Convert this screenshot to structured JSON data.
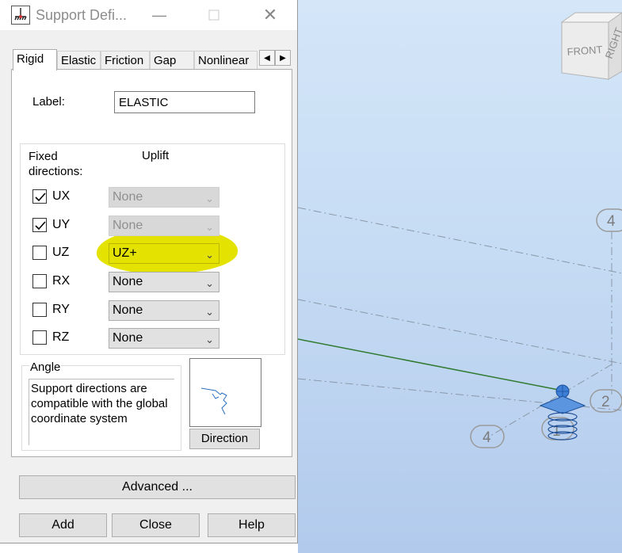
{
  "dialog": {
    "title": "Support Defi...",
    "tabs": [
      "Rigid",
      "Elastic",
      "Friction",
      "Gap",
      "Nonlinear"
    ],
    "active_tab": "Rigid",
    "label_caption": "Label:",
    "label_value": "ELASTIC",
    "fixed_header": "Fixed directions:",
    "uplift_header": "Uplift",
    "dofs": [
      {
        "name": "UX",
        "checked": true,
        "uplift": "None",
        "enabled": false
      },
      {
        "name": "UY",
        "checked": true,
        "uplift": "None",
        "enabled": false
      },
      {
        "name": "UZ",
        "checked": false,
        "uplift": "UZ+",
        "enabled": true,
        "highlighted": true
      },
      {
        "name": "RX",
        "checked": false,
        "uplift": "None",
        "enabled": true
      },
      {
        "name": "RY",
        "checked": false,
        "uplift": "None",
        "enabled": true
      },
      {
        "name": "RZ",
        "checked": false,
        "uplift": "None",
        "enabled": true
      }
    ],
    "angle_title": "Angle",
    "angle_text": "Support directions are compatible with the global coordinate system",
    "direction_label": "Direction",
    "advanced_label": "Advanced ...",
    "add_label": "Add",
    "close_label": "Close",
    "help_label": "Help",
    "highlight_color": "#e4e200"
  },
  "viewport": {
    "cube_front": "FRONT",
    "cube_right": "RIGHT",
    "node_labels": [
      "4",
      "2",
      "4",
      "1"
    ],
    "background": "#c6dcf4",
    "support_color": "#3d7fd6"
  }
}
